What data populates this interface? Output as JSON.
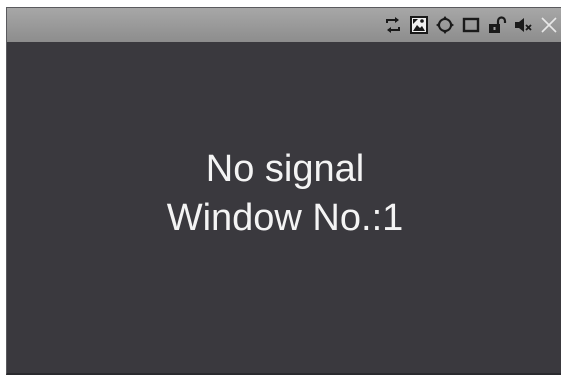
{
  "window": {
    "status_message": "No signal",
    "window_label": "Window No.:1"
  },
  "toolbar": {
    "buttons": [
      {
        "icon": "swap-arrows-icon"
      },
      {
        "icon": "picture-icon"
      },
      {
        "icon": "move-arrows-icon"
      },
      {
        "icon": "maximize-icon"
      },
      {
        "icon": "unlock-icon"
      },
      {
        "icon": "mute-speaker-icon"
      },
      {
        "icon": "close-icon"
      }
    ]
  },
  "colors": {
    "title_bar": "#9a9a9a",
    "content_background": "#3a393e",
    "text": "#f4f4f4",
    "icon": "#1a1a1a"
  }
}
